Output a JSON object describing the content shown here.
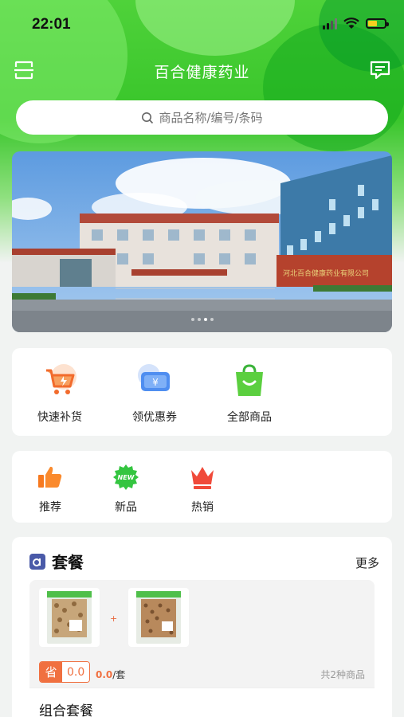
{
  "status_bar": {
    "time": "22:01"
  },
  "header": {
    "title": "百合健康药业",
    "scan_icon": "scan-icon",
    "message_icon": "message-icon"
  },
  "search": {
    "placeholder": "商品名称/编号/条码",
    "icon": "search-icon"
  },
  "banner": {
    "slide_count": 4,
    "active_slide": 3,
    "sign_text": "河北百合健康药业有限公司"
  },
  "quick_actions": [
    {
      "label": "快速补货",
      "icon": "cart-lightning-icon"
    },
    {
      "label": "领优惠券",
      "icon": "coupon-icon"
    },
    {
      "label": "全部商品",
      "icon": "shopping-bag-icon"
    }
  ],
  "categories": [
    {
      "label": "推荐",
      "icon": "thumbs-up-icon"
    },
    {
      "label": "新品",
      "icon": "new-badge-icon",
      "badge_text": "NEW"
    },
    {
      "label": "热销",
      "icon": "crown-icon"
    }
  ],
  "package": {
    "title": "套餐",
    "more": "更多",
    "combo": {
      "save_label": "省",
      "save_value": "0.0",
      "price": "0.0",
      "unit": "/套",
      "count_text": "共2种商品",
      "name": "组合套餐"
    }
  },
  "colors": {
    "brand_green": "#38c52a",
    "accent_orange": "#f07040"
  }
}
